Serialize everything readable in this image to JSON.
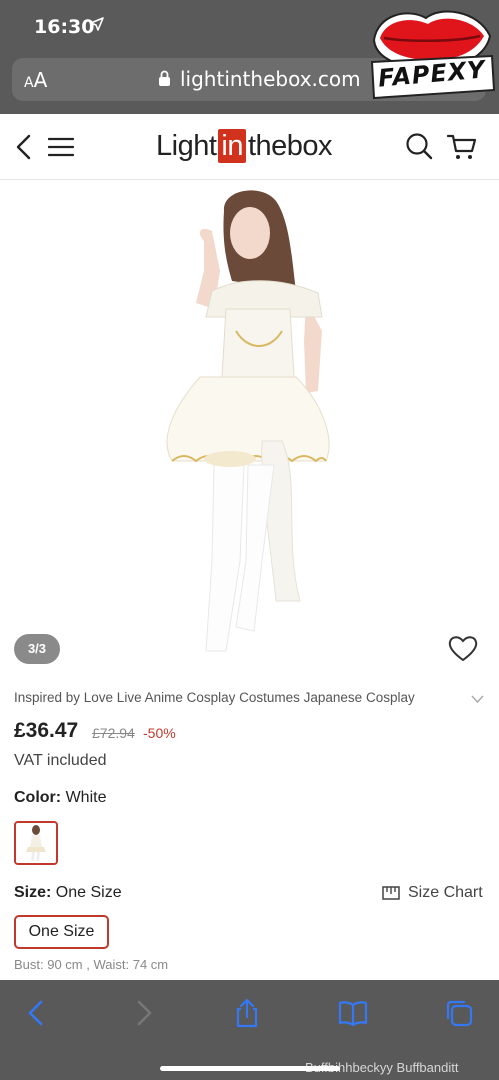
{
  "status_bar": {
    "time": "16:30"
  },
  "url_bar": {
    "text_size": "AA",
    "host": "lightinthebox.com"
  },
  "watermark": {
    "sticker_text": "FAPEXY",
    "footer_text": "Buffbihhbeckyy Buffbanditt"
  },
  "header": {
    "logo_left": "Light",
    "logo_mid": "in",
    "logo_right": "thebox"
  },
  "gallery": {
    "counter": "3/3"
  },
  "product": {
    "title": "Inspired by Love Live Anime Cosplay Costumes Japanese Cosplay",
    "price": "£36.47",
    "old_price": "£72.94",
    "discount": "-50%",
    "vat": "VAT included"
  },
  "color": {
    "label": "Color:",
    "value": "White"
  },
  "size": {
    "label": "Size:",
    "value": "One Size",
    "chart_label": "Size Chart",
    "option": "One Size",
    "measurements": "Bust: 90 cm , Waist: 74 cm"
  },
  "colors": {
    "accent": "#c0392b",
    "logo_red": "#d0321e",
    "toolbar_blue": "#3478f6"
  }
}
